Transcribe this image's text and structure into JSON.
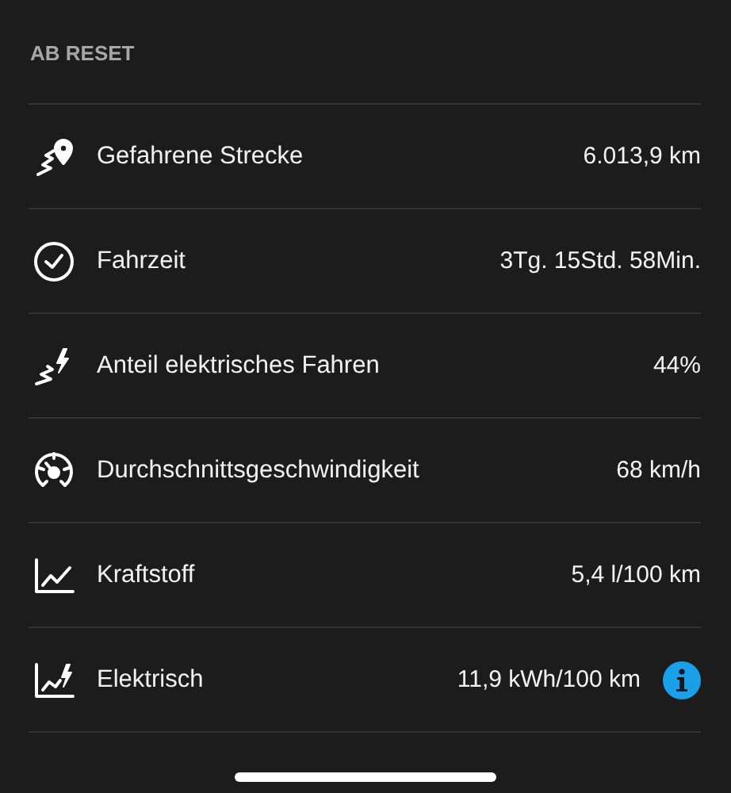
{
  "section_title": "AB RESET",
  "rows": [
    {
      "label": "Gefahrene Strecke",
      "value": "6.013,9 km",
      "info": false
    },
    {
      "label": "Fahrzeit",
      "value": "3Tg. 15Std. 58Min.",
      "info": false
    },
    {
      "label": "Anteil elektrisches Fahren",
      "value": "44%",
      "info": false
    },
    {
      "label": "Durchschnittsgeschwindigkeit",
      "value": "68 km/h",
      "info": false
    },
    {
      "label": "Kraftstoff",
      "value": "5,4 l/100 km",
      "info": false
    },
    {
      "label": "Elektrisch",
      "value": "11,9 kWh/100 km",
      "info": true
    }
  ]
}
